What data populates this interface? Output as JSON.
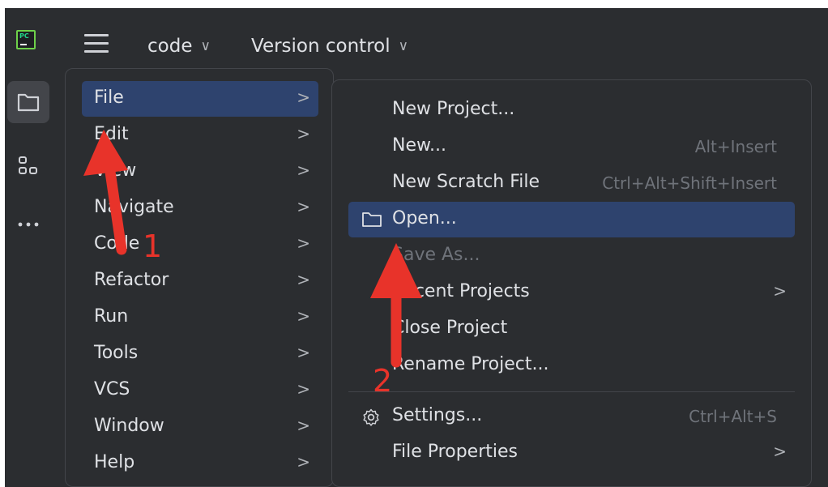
{
  "titlebar": {
    "logo_text": "PC",
    "project_menu": "code",
    "vcs_menu": "Version control"
  },
  "toolstrip": {
    "icons": [
      "folder-icon",
      "structure-icon",
      "more-icon"
    ]
  },
  "main_menu": {
    "items": [
      {
        "label": "File",
        "selected": true
      },
      {
        "label": "Edit"
      },
      {
        "label": "View"
      },
      {
        "label": "Navigate"
      },
      {
        "label": "Code"
      },
      {
        "label": "Refactor"
      },
      {
        "label": "Run"
      },
      {
        "label": "Tools"
      },
      {
        "label": "VCS"
      },
      {
        "label": "Window"
      },
      {
        "label": "Help"
      }
    ],
    "submenu_arrow": ">"
  },
  "file_menu": {
    "items": [
      {
        "label": "New Project..."
      },
      {
        "label": "New...",
        "shortcut": "Alt+Insert"
      },
      {
        "label": "New Scratch File",
        "shortcut": "Ctrl+Alt+Shift+Insert"
      },
      {
        "label": "Open...",
        "selected": true,
        "icon": "folder-icon"
      },
      {
        "label": "Save As...",
        "disabled": true
      },
      {
        "label": "Recent Projects",
        "submenu": true
      },
      {
        "label": "Close Project"
      },
      {
        "label": "Rename Project..."
      },
      {
        "label": "Settings...",
        "shortcut": "Ctrl+Alt+S",
        "icon": "gear-icon"
      },
      {
        "label": "File Properties",
        "submenu": true
      }
    ],
    "submenu_arrow": ">"
  },
  "annotations": {
    "arrow_color": "#e8332a",
    "step_1": "1",
    "step_2": "2"
  },
  "colors": {
    "background": "#2b2d30",
    "selection": "#2e436e",
    "text": "#dfe1e5",
    "muted": "#6f737a"
  }
}
